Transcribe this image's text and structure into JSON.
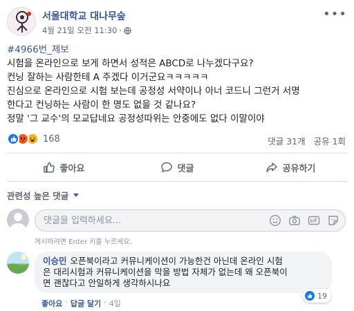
{
  "header": {
    "page_name": "서울대학교 대나무숲",
    "timestamp": "4월 21일 오전 11:30",
    "separator": "·",
    "more_icon": "more-horizontal-icon"
  },
  "post": {
    "hashtag": "#4966번_제보",
    "lines": [
      "시험을 온라인으로 보게 하면서 성적은 ABCD로 나누겠다구요?",
      "컨닝 잘하는 사람한테 A 주겠다 이거군요ㅋㅋㅋㅋㅋ",
      "진심으로 온라인으로 시험 보는데 공정성 서약이나 아너 코드니 그런거 서명",
      "한다고 컨닝하는 사람이 한 명도 없을 것 같나요?",
      "정말 '그 교수'의 모교답네요 공정성따위는 안중에도 없다 이말이야"
    ]
  },
  "stats": {
    "reaction_count": "168",
    "reactions": [
      "like",
      "angry",
      "haha"
    ],
    "comments": "댓글 31개",
    "shares": "공유 1회"
  },
  "actions": {
    "like": "좋아요",
    "comment": "댓글",
    "share": "공유하기"
  },
  "comments_section": {
    "sort_label": "관련성 높은 댓글",
    "input_placeholder": "댓글을 입력하세요...",
    "input_hint": "게시하려면 Enter 키를 누르세요.",
    "comment": {
      "author": "이승민",
      "lines": [
        "오픈북이라고 커뮤니케이션이 가능한건 아닌데 온라인 시험",
        "은 대리시험과 커뮤니케이션을 막을 방법 자체가 없는데 왜 오픈북이",
        "면 괜찮다고 안일하게 생각하시나요"
      ],
      "reaction_count": "19",
      "like_label": "좋아요",
      "reply_label": "답글 달기",
      "dot": "·",
      "age": "4일"
    }
  },
  "colors": {
    "link_blue": "#385898",
    "like_blue": "#1877f2",
    "muted": "#606770"
  }
}
